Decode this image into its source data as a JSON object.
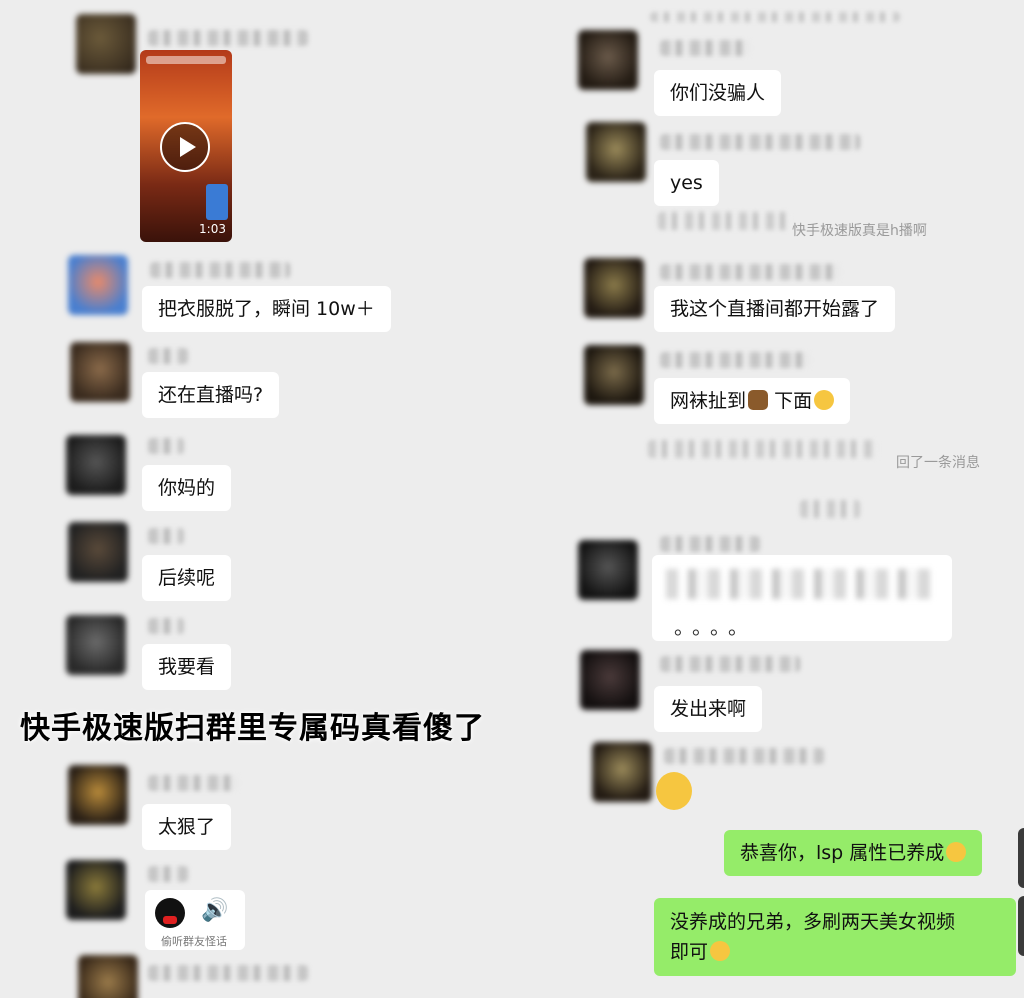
{
  "overlay_title": "快手极速版扫群里专属码真看傻了",
  "left_chat": {
    "video": {
      "duration": "1:03"
    },
    "messages": [
      {
        "text": "把衣服脱了，瞬间 10w＋"
      },
      {
        "text": "还在直播吗?"
      },
      {
        "text": "你妈的"
      },
      {
        "text": "后续呢"
      },
      {
        "text": "我要看"
      },
      {
        "text": "太狠了"
      }
    ],
    "voice_caption": "偷听群友怪话"
  },
  "right_chat": {
    "messages": [
      {
        "text": "你们没骗人"
      },
      {
        "text": "yes"
      },
      {
        "text": "我这个直播间都开始露了"
      },
      {
        "text": "网袜扯到"
      },
      {
        "text": "下面"
      },
      {
        "text": "发出来啊"
      }
    ],
    "system_notes": [
      {
        "text": "快手极速版真是h播啊"
      },
      {
        "text": "回了一条消息"
      }
    ],
    "dots": "。。。。",
    "own_messages": [
      {
        "text": "恭喜你，lsp 属性已养成"
      },
      {
        "text": "没养成的兄弟，多刷两天美女视频"
      },
      {
        "text": "即可"
      }
    ]
  },
  "colors": {
    "background": "#ededed",
    "incoming_bubble": "#ffffff",
    "outgoing_bubble": "#95ec69"
  }
}
